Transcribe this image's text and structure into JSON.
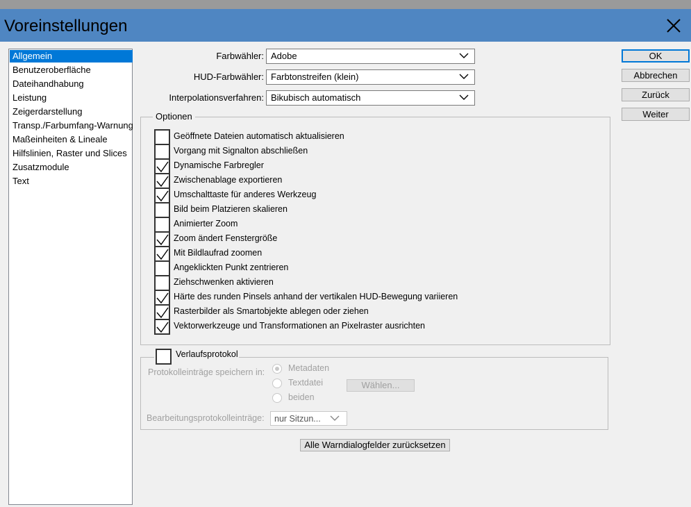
{
  "window": {
    "title": "Voreinstellungen"
  },
  "sidebar": {
    "items": [
      {
        "label": "Allgemein",
        "selected": true
      },
      {
        "label": "Benutzeroberfläche",
        "selected": false
      },
      {
        "label": "Dateihandhabung",
        "selected": false
      },
      {
        "label": "Leistung",
        "selected": false
      },
      {
        "label": "Zeigerdarstellung",
        "selected": false
      },
      {
        "label": "Transp./Farbumfang-Warnung",
        "selected": false
      },
      {
        "label": "Maßeinheiten & Lineale",
        "selected": false
      },
      {
        "label": "Hilfslinien, Raster und Slices",
        "selected": false
      },
      {
        "label": "Zusatzmodule",
        "selected": false
      },
      {
        "label": "Text",
        "selected": false
      }
    ]
  },
  "fields": {
    "farbwaehler_label": "Farbwähler:",
    "farbwaehler_value": "Adobe",
    "hud_label": "HUD-Farbwähler:",
    "hud_value": "Farbtonstreifen (klein)",
    "interp_label": "Interpolationsverfahren:",
    "interp_value": "Bikubisch automatisch"
  },
  "options": {
    "legend": "Optionen",
    "items": [
      {
        "label": "Geöffnete Dateien automatisch aktualisieren",
        "checked": false
      },
      {
        "label": "Vorgang mit Signalton abschließen",
        "checked": false
      },
      {
        "label": "Dynamische Farbregler",
        "checked": true
      },
      {
        "label": "Zwischenablage exportieren",
        "checked": true
      },
      {
        "label": "Umschalttaste für anderes Werkzeug",
        "checked": true
      },
      {
        "label": "Bild beim Platzieren skalieren",
        "checked": false
      },
      {
        "label": "Animierter Zoom",
        "checked": false
      },
      {
        "label": "Zoom ändert Fenstergröße",
        "checked": true
      },
      {
        "label": "Mit Bildlaufrad zoomen",
        "checked": true
      },
      {
        "label": "Angeklickten Punkt zentrieren",
        "checked": false
      },
      {
        "label": "Ziehschwenken aktivieren",
        "checked": false
      },
      {
        "label": "Härte des runden Pinsels anhand der vertikalen HUD-Bewegung variieren",
        "checked": true
      },
      {
        "label": "Rasterbilder als Smartobjekte ablegen oder ziehen",
        "checked": true
      },
      {
        "label": "Vektorwerkzeuge und Transformationen an Pixelraster ausrichten",
        "checked": true
      }
    ]
  },
  "history": {
    "legend": "Verlaufsprotokol",
    "checked": false,
    "save_label": "Protokolleinträge speichern in:",
    "radio_metadaten": "Metadaten",
    "radio_textdatei": "Textdatei",
    "radio_beiden": "beiden",
    "selected_radio": "Metadaten",
    "choose_button": "Wählen...",
    "edit_label": "Bearbeitungsprotokolleinträge:",
    "edit_value": "nur Sitzun..."
  },
  "reset_button": "Alle Warndialogfelder zurücksetzen",
  "buttons": {
    "ok": "OK",
    "cancel": "Abbrechen",
    "back": "Zurück",
    "next": "Weiter"
  },
  "colors": {
    "titlebar": "#4f86c2",
    "selection": "#0078d7"
  }
}
